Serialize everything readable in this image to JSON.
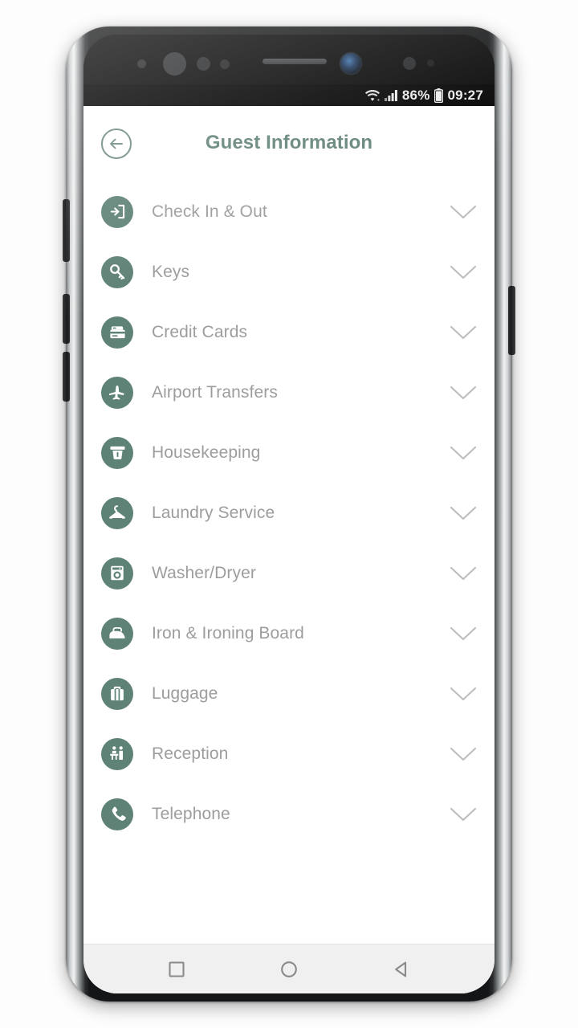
{
  "statusbar": {
    "wifi_icon": "wifi-icon",
    "signal_icon": "cellular-signal-icon",
    "battery_percent": "86%",
    "battery_icon": "battery-icon",
    "time": "09:27"
  },
  "header": {
    "back_icon": "back-arrow-icon",
    "title": "Guest Information",
    "title_color": "#63847a"
  },
  "theme": {
    "icon_circle_color": "#5f8276",
    "label_color": "#9d9d9d",
    "chevron_color": "#bdbdbd",
    "screen_background": "#ffffff"
  },
  "list": {
    "items": [
      {
        "label": "Check In & Out",
        "icon": "check-in-door-arrow-icon",
        "chevron": "chevron-down-icon"
      },
      {
        "label": "Keys",
        "icon": "key-icon",
        "chevron": "chevron-down-icon"
      },
      {
        "label": "Credit Cards",
        "icon": "credit-card-icon",
        "chevron": "chevron-down-icon"
      },
      {
        "label": "Airport Transfers",
        "icon": "airplane-icon",
        "chevron": "chevron-down-icon"
      },
      {
        "label": "Housekeeping",
        "icon": "housekeeping-broom-icon",
        "chevron": "chevron-down-icon"
      },
      {
        "label": "Laundry Service",
        "icon": "clothes-hanger-icon",
        "chevron": "chevron-down-icon"
      },
      {
        "label": "Washer/Dryer",
        "icon": "washing-machine-icon",
        "chevron": "chevron-down-icon"
      },
      {
        "label": "Iron & Ironing Board",
        "icon": "iron-icon",
        "chevron": "chevron-down-icon"
      },
      {
        "label": "Luggage",
        "icon": "suitcase-icon",
        "chevron": "chevron-down-icon"
      },
      {
        "label": "Reception",
        "icon": "reception-desk-icon",
        "chevron": "chevron-down-icon"
      },
      {
        "label": "Telephone",
        "icon": "telephone-handset-icon",
        "chevron": "chevron-down-icon"
      }
    ]
  },
  "navbar": {
    "recents": "recents-square-icon",
    "home": "home-circle-icon",
    "back": "back-triangle-icon"
  },
  "device": {
    "earpiece": "earpiece-speaker",
    "front_camera": "front-camera",
    "power_button": "power-button",
    "volume_up_button": "volume-up-button",
    "volume_down_button": "volume-down-button",
    "bixby_button": "bixby-button"
  }
}
